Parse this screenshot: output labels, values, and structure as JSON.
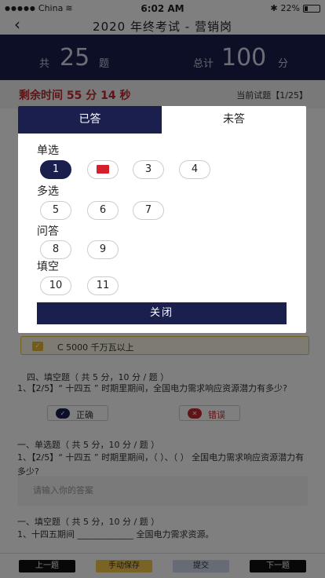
{
  "status_bar": {
    "carrier": "China",
    "time": "6:02 AM",
    "battery": "22%"
  },
  "nav": {
    "title": "2020 年终考试 - 营销岗"
  },
  "banner": {
    "total_label": "共",
    "total_count": "25",
    "count_unit": "题",
    "score_label": "总计",
    "score_total": "100",
    "score_unit": "分"
  },
  "timer": {
    "remaining": "剩余时间  55 分 14 秒",
    "current": "当前试题【1/25】"
  },
  "content": {
    "option_c": "C  5000 千万瓦以上",
    "section4_title": "四、填空题（ 共 5 分，10 分 / 题 ）",
    "q_power": "1、【2/5】“ 十四五 ” 时期里期间，全国电力需求响应资源潜力有多少?",
    "correct_label": "正确",
    "wrong_label": "错误",
    "section1_title": "一、单选题（ 共 5 分，10 分 / 题 ）",
    "q_single": "1、【2/5】“ 十四五 ” 时期里期间，（ ）、（ ） 全国电力需求响应资源潜力有多少?",
    "answer_placeholder": "请输入你的答案",
    "section_fill_title": "一、填空题（ 共 5 分，10 分 / 题 ）",
    "q_fill": "1、十四五期间 _____________ 全国电力需求资源。"
  },
  "footer": {
    "prev": "上一题",
    "save": "手动保存",
    "submit": "提交",
    "next": "下一题"
  },
  "modal": {
    "tab_answered": "已答",
    "tab_unanswered": "未答",
    "sections": [
      {
        "label": "单选",
        "items": [
          "1",
          "",
          "3",
          "4"
        ]
      },
      {
        "label": "多选",
        "items": [
          "5",
          "6",
          "7"
        ]
      },
      {
        "label": "问答",
        "items": [
          "8",
          "9"
        ]
      },
      {
        "label": "填空",
        "items": [
          "10",
          "11"
        ]
      }
    ],
    "close": "关闭"
  },
  "colors": {
    "navy": "#1b1f4d",
    "timer_red": "#c0282e",
    "flag_red": "#d4202a"
  },
  "icons": {
    "back": "chevron-left-icon",
    "flag": "flag-icon",
    "wifi": "wifi-icon",
    "bluetooth": "bluetooth-icon"
  }
}
